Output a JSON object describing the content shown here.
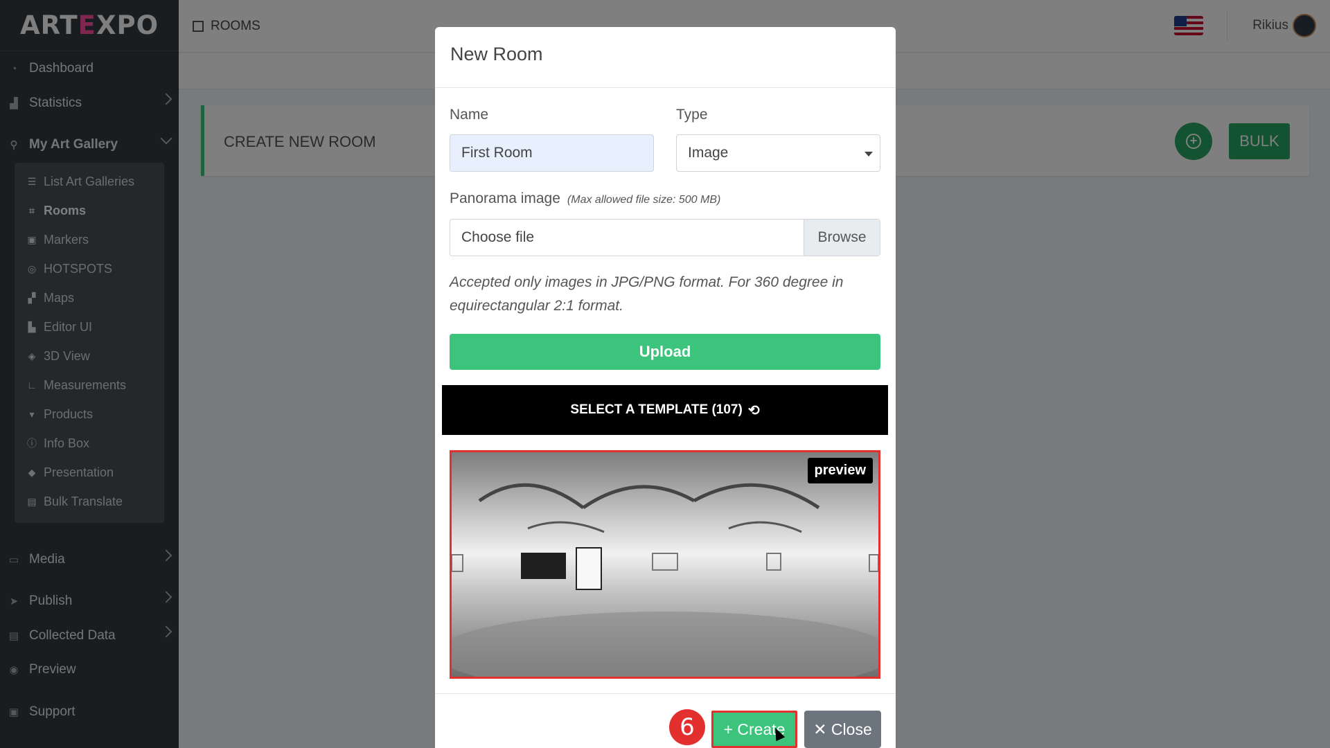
{
  "app": {
    "logo_left": "ART",
    "logo_mid": "E",
    "logo_right": "XPO"
  },
  "sidebar": {
    "items_top": [
      {
        "label": "Dashboard",
        "icon": "dashboard-icon"
      },
      {
        "label": "Statistics",
        "icon": "chart-icon"
      },
      {
        "label": "My Art Gallery",
        "icon": "gallery-icon"
      }
    ],
    "submenu": [
      {
        "label": "List Art Galleries",
        "icon": "list-icon"
      },
      {
        "label": "Rooms",
        "icon": "room-icon"
      },
      {
        "label": "Markers",
        "icon": "marker-icon"
      },
      {
        "label": "HOTSPOTS",
        "icon": "target-icon"
      },
      {
        "label": "Maps",
        "icon": "map-icon"
      },
      {
        "label": "Editor UI",
        "icon": "editor-icon"
      },
      {
        "label": "3D View",
        "icon": "cube-icon"
      },
      {
        "label": "Measurements",
        "icon": "ruler-icon"
      },
      {
        "label": "Products",
        "icon": "cart-icon"
      },
      {
        "label": "Info Box",
        "icon": "info-icon"
      },
      {
        "label": "Presentation",
        "icon": "presentation-icon"
      },
      {
        "label": "Bulk Translate",
        "icon": "translate-icon"
      }
    ],
    "items_bottom": [
      {
        "label": "Media",
        "icon": "media-icon"
      },
      {
        "label": "Publish",
        "icon": "publish-icon"
      },
      {
        "label": "Collected Data",
        "icon": "data-icon"
      },
      {
        "label": "Preview",
        "icon": "eye-icon"
      },
      {
        "label": "Support",
        "icon": "support-icon"
      }
    ]
  },
  "topbar": {
    "breadcrumb": "ROOMS",
    "user": "Rikius"
  },
  "content": {
    "card_title": "CREATE NEW ROOM",
    "add_symbol": "+",
    "bulk_label": "BULK"
  },
  "modal": {
    "title": "New Room",
    "name_label": "Name",
    "name_value": "First Room",
    "type_label": "Type",
    "type_value": "Image",
    "panorama_label": "Panorama image",
    "panorama_note": "(Max allowed file size: 500 MB)",
    "file_placeholder": "Choose file",
    "browse_label": "Browse",
    "help_text": "Accepted only images in JPG/PNG format. For 360 degree in equirectangular 2:1 format.",
    "upload_label": "Upload",
    "template_label": "SELECT A TEMPLATE (107)",
    "history_glyph": "⟲",
    "preview_badge": "preview",
    "step_number": "6",
    "create_label": "+ Create",
    "close_label": "✕ Close"
  },
  "colors": {
    "accent_green": "#3cc47c",
    "highlight_red": "#e3302f",
    "sidebar_bg": "#343a40"
  }
}
